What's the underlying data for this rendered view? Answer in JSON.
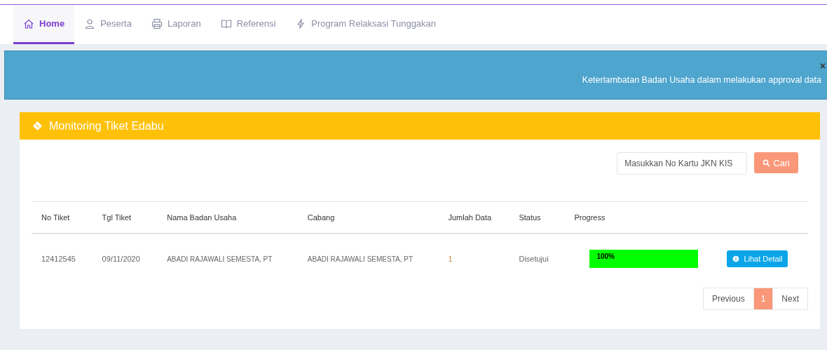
{
  "nav": [
    {
      "label": "Home",
      "selected": true
    },
    {
      "label": "Peserta",
      "selected": false
    },
    {
      "label": "Laporan",
      "selected": false
    },
    {
      "label": "Referensi",
      "selected": false
    },
    {
      "label": "Program Relaksasi Tunggakan",
      "selected": false
    }
  ],
  "banner": {
    "close": "×",
    "message": "Keterlambatan Badan Usaha dalam melakukan approval data"
  },
  "card": {
    "title": "Monitoring Tiket Edabu",
    "search": {
      "placeholder": "Masukkan No Kartu JKN KIS",
      "button": "Cari"
    }
  },
  "table": {
    "columns": [
      "No Tiket",
      "Tgl Tiket",
      "Nama Badan Usaha",
      "Cabang",
      "Jumlah Data",
      "Status",
      "Progress"
    ],
    "rows": [
      {
        "no_tiket": "12412545",
        "tgl_tiket": "09/11/2020",
        "nama_badan_usaha": "ABADI RAJAWALI SEMESTA, PT",
        "cabang": "ABADI RAJAWALI SEMESTA, PT",
        "jumlah_data": "1",
        "status": "Disetujui",
        "progress": {
          "level": 1,
          "label": "100%"
        },
        "action": "Lihat Detail"
      }
    ]
  },
  "pagination": {
    "previous": "Previous",
    "pages": [
      {
        "label": "1",
        "selected": true
      }
    ],
    "next": "Next"
  }
}
